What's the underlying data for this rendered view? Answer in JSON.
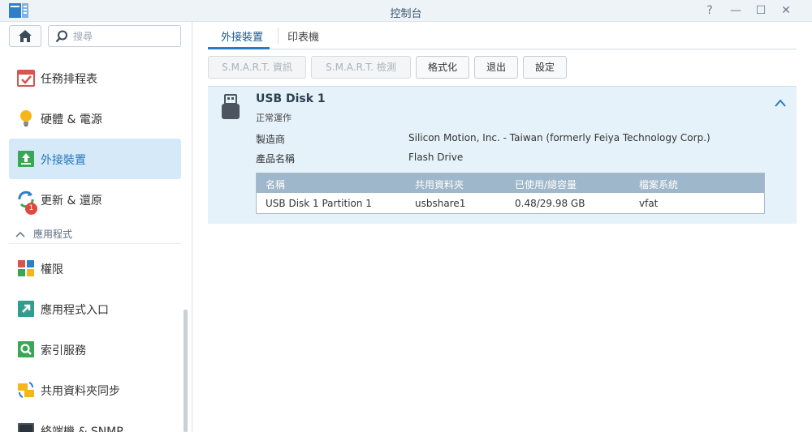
{
  "window": {
    "title": "控制台",
    "help_glyph": "?",
    "minimize_glyph": "—",
    "maximize_glyph": "☐",
    "close_glyph": "✕"
  },
  "sidebar": {
    "search_placeholder": "搜尋",
    "items": [
      {
        "label": "任務排程表",
        "icon": "task-scheduler-icon"
      },
      {
        "label": "硬體 & 電源",
        "icon": "hardware-power-icon"
      },
      {
        "label": "外接裝置",
        "icon": "external-devices-icon",
        "active": true
      },
      {
        "label": "更新 & 還原",
        "icon": "update-restore-icon",
        "badge": "1"
      }
    ],
    "section": {
      "label": "應用程式",
      "chevron": "^"
    },
    "app_items": [
      {
        "label": "權限",
        "icon": "privileges-icon"
      },
      {
        "label": "應用程式入口",
        "icon": "application-portal-icon"
      },
      {
        "label": "索引服務",
        "icon": "indexing-service-icon"
      },
      {
        "label": "共用資料夾同步",
        "icon": "shared-folder-sync-icon"
      },
      {
        "label": "終端機 & SNMP",
        "icon": "terminal-snmp-icon"
      }
    ]
  },
  "tabs": [
    {
      "label": "外接裝置",
      "active": true
    },
    {
      "label": "印表機",
      "active": false
    }
  ],
  "toolbar": {
    "smart_info": "S.M.A.R.T. 資訊",
    "smart_test": "S.M.A.R.T. 檢測",
    "format": "格式化",
    "eject": "退出",
    "settings": "設定"
  },
  "device": {
    "name": "USB Disk 1",
    "status": "正常運作",
    "vendor_label": "製造商",
    "vendor_value": "Silicon Motion, Inc. - Taiwan (formerly Feiya Technology Corp.)",
    "product_label": "產品名稱",
    "product_value": "Flash Drive",
    "table": {
      "columns": [
        "名稱",
        "共用資料夾",
        "已使用/總容量",
        "檔案系統"
      ],
      "rows": [
        [
          "USB Disk 1 Partition 1",
          "usbshare1",
          "0.48/29.98 GB",
          "vfat"
        ]
      ]
    }
  },
  "colors": {
    "accent": "#2a7dc4",
    "active_bg": "#d5e9f8",
    "panel_bg": "#e6f2fa",
    "table_header": "#9fb7ca",
    "badge": "#e0483b"
  }
}
